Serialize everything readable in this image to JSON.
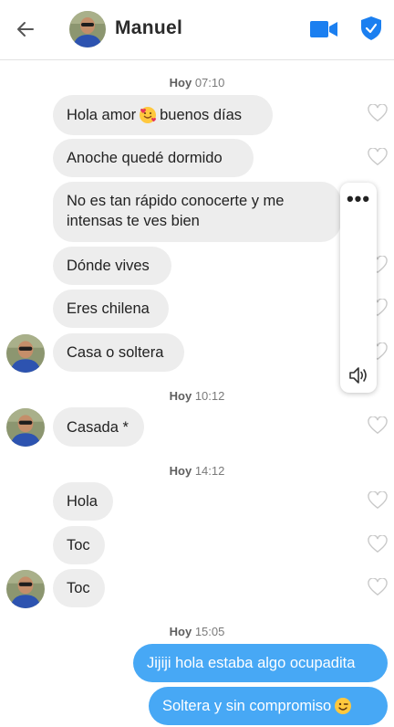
{
  "header": {
    "contact_name": "Manuel",
    "back_icon": "arrow-left-icon",
    "video_icon": "video-camera-icon",
    "safety_icon": "shield-icon",
    "accent_color": "#1b7ff0"
  },
  "timestamps": [
    {
      "day": "Hoy",
      "time": "07:10"
    },
    {
      "day": "Hoy",
      "time": "10:12"
    },
    {
      "day": "Hoy",
      "time": "14:12"
    },
    {
      "day": "Hoy",
      "time": "15:05"
    }
  ],
  "messages": [
    {
      "from": "them",
      "before": "Hola amor",
      "emoji": "smiling-face-with-hearts",
      "after": "buenos días"
    },
    {
      "from": "them",
      "text": "Anoche quedé dormido"
    },
    {
      "from": "them",
      "line1": "No es tan rápido conocerte y me",
      "line2": "intensas te ves bien"
    },
    {
      "from": "them",
      "text": "Dónde vives"
    },
    {
      "from": "them",
      "text": "Eres chilena"
    },
    {
      "from": "them",
      "text": "Casa o soltera"
    },
    {
      "from": "them",
      "text": "Casada *"
    },
    {
      "from": "them",
      "text": "Hola"
    },
    {
      "from": "them",
      "text": "Toc"
    },
    {
      "from": "them",
      "text": "Toc"
    },
    {
      "from": "me",
      "text": "Jijiji hola estaba algo ocupadita"
    },
    {
      "from": "me",
      "text": "Soltera  y sin compromiso",
      "emoji": "winking-face"
    }
  ],
  "colors": {
    "incoming_bubble": "#ededed",
    "outgoing_bubble": "#47a8f5"
  },
  "popup": {
    "more_icon": "more-dots-icon",
    "speaker_icon": "speaker-icon"
  }
}
